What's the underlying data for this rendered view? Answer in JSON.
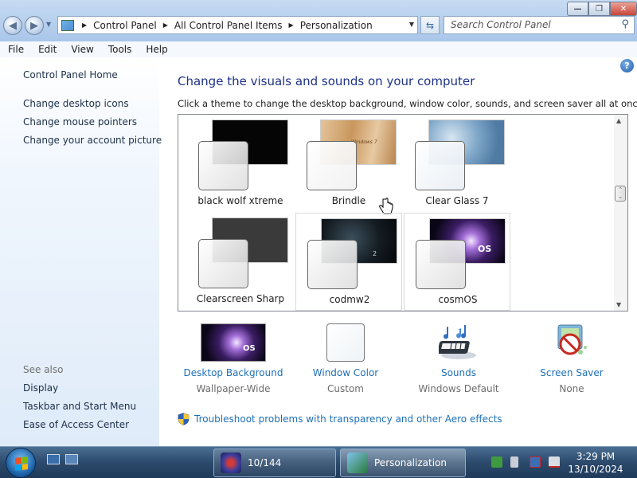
{
  "window": {
    "breadcrumbs": [
      "Control Panel",
      "All Control Panel Items",
      "Personalization"
    ],
    "search_placeholder": "Search Control Panel"
  },
  "menu": [
    "File",
    "Edit",
    "View",
    "Tools",
    "Help"
  ],
  "sidebar": {
    "home": "Control Panel Home",
    "links": [
      "Change desktop icons",
      "Change mouse pointers",
      "Change your account picture"
    ],
    "see_also_label": "See also",
    "see_also": [
      "Display",
      "Taskbar and Start Menu",
      "Ease of Access Center"
    ]
  },
  "main": {
    "title": "Change the visuals and sounds on your computer",
    "subtitle": "Click a theme to change the desktop background, window color, sounds, and screen saver all at once.",
    "themes": [
      {
        "name": "black wolf xtreme",
        "wallpaper": "#050505"
      },
      {
        "name": "Brindle",
        "wallpaper_text": "Windows 7"
      },
      {
        "name": "Clear Glass 7",
        "wallpaper": "#8fb4d4"
      },
      {
        "name": "Clearscreen Sharp",
        "wallpaper": "#3a3a3a"
      },
      {
        "name": "codmw2",
        "wallpaper_text": "2"
      },
      {
        "name": "cosmOS",
        "wallpaper_text": "OS"
      }
    ],
    "settings": [
      {
        "link": "Desktop Background",
        "value": "Wallpaper-Wide",
        "thumb_text": "OS"
      },
      {
        "link": "Window Color",
        "value": "Custom"
      },
      {
        "link": "Sounds",
        "value": "Windows Default"
      },
      {
        "link": "Screen Saver",
        "value": "None"
      }
    ],
    "troubleshoot": "Troubleshoot problems with transparency and other Aero effects"
  },
  "taskbar": {
    "items": [
      {
        "label": "10/144",
        "active": false
      },
      {
        "label": "Personalization",
        "active": true
      }
    ],
    "time": "3:29 PM",
    "date": "13/10/2024"
  },
  "colors": {
    "link": "#1e6fb5",
    "title": "#1e3287",
    "taskbar": "#2c4a6c"
  }
}
